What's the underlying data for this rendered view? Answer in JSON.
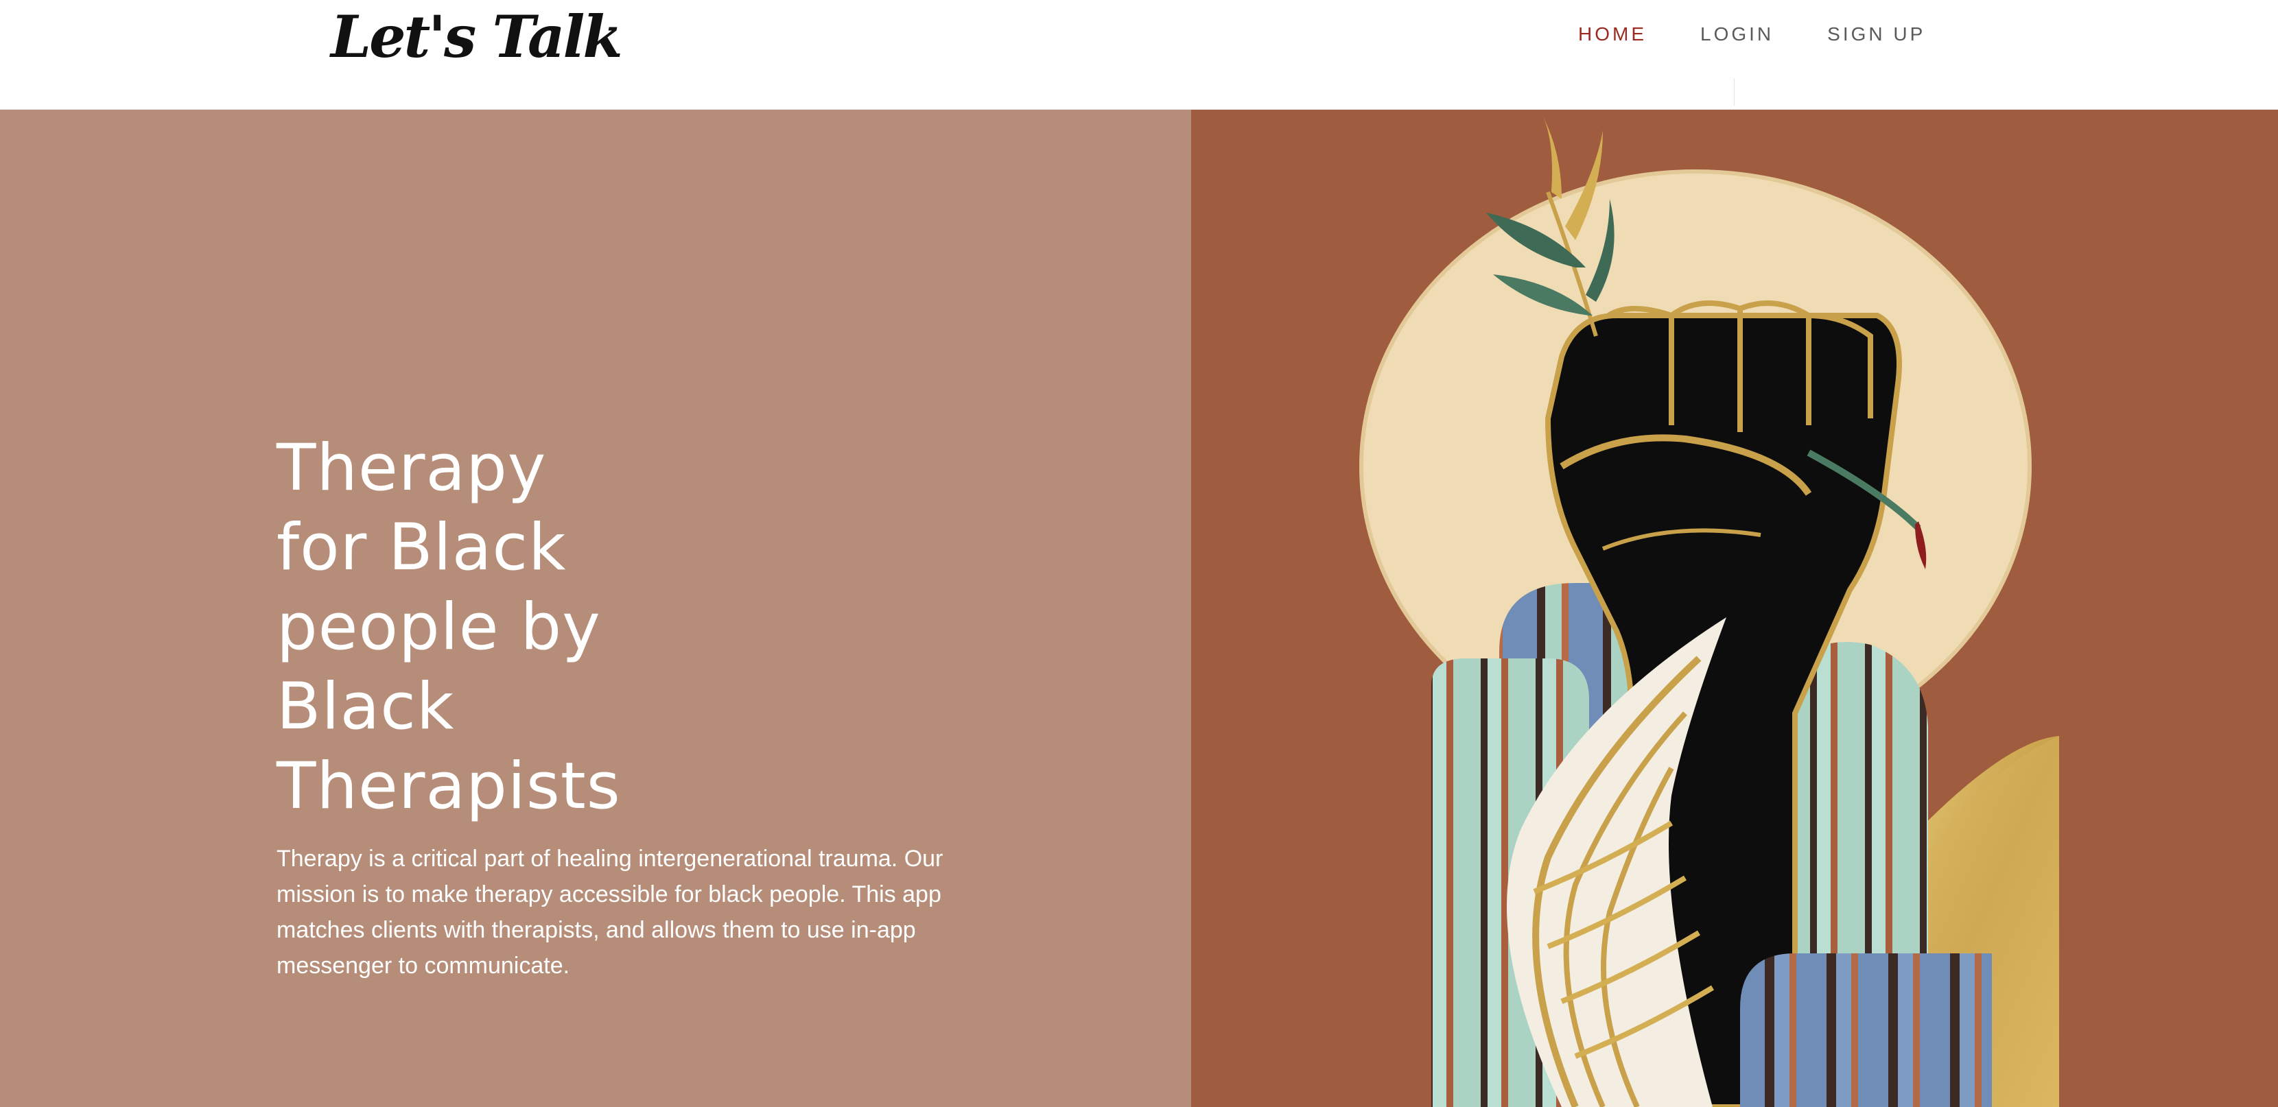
{
  "brand": {
    "logo_text": "Let's Talk"
  },
  "nav": {
    "items": [
      {
        "label": "HOME",
        "active": true
      },
      {
        "label": "LOGIN",
        "active": false
      },
      {
        "label": "SIGN UP",
        "active": false
      }
    ]
  },
  "hero": {
    "title_lines": [
      "Therapy",
      "for Black",
      "people by",
      "Black",
      "Therapists"
    ],
    "description": "Therapy is a critical part of healing intergenerational trauma. Our mission is to make therapy accessible for black people. This app matches clients with therapists, and allows them to use in-app messenger to communicate."
  },
  "artwork": {
    "icon": "raised-fist-artwork-icon"
  },
  "colors": {
    "nav_active": "#9b2a22",
    "nav_default": "#5a5a5a",
    "hero_left_bg": "#b68d78",
    "hero_right_bg": "#9c5a3e",
    "sun": "#efdbb4",
    "fist": "#0d0d0d",
    "gold": "#d4ae53",
    "stripe_blue": "#6f8db7",
    "stripe_mint": "#aad3c4",
    "stripe_brown": "#3e2a24"
  }
}
